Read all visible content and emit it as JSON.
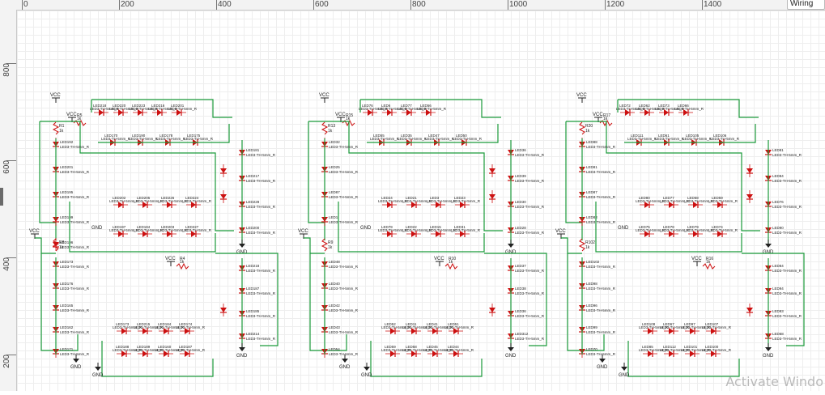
{
  "ruler": {
    "top_labels": [
      "0",
      "200",
      "400",
      "600",
      "800",
      "1000",
      "1200",
      "1400"
    ],
    "left_labels": [
      "800",
      "600",
      "400",
      "200"
    ]
  },
  "top_right_tab": "Wiring",
  "watermark": "Activate Windo",
  "schematic": {
    "net_label_vcc": "VCC",
    "net_label_gnd": "GND",
    "part_name": "LED3-TH-5mm_R",
    "resistor_value": "1k",
    "blocks": [
      {
        "resistors": [
          "R1",
          "R5",
          "R8"
        ],
        "leds_top": [
          "LED218",
          "LED220",
          "LED223",
          "LED216",
          "LED201"
        ],
        "leds_mid": [
          "LED170",
          "LED190",
          "LED178",
          "LED175"
        ],
        "leds_left": [
          "LED192",
          "LED201",
          "LED195",
          "LED199",
          "LED196"
        ],
        "leds_right": [
          "LED181",
          "LED217",
          "LED228",
          "LED200"
        ],
        "leds_row": [
          "LED202",
          "LED205",
          "LED226",
          "LED224",
          "LED197",
          "LED184",
          "LED203",
          "LED227"
        ],
        "leds_lower_left": [
          "LED173",
          "LED176",
          "LED165",
          "LED162",
          "LED171"
        ],
        "leds_lower_right": [
          "LED218",
          "LED187",
          "LED185",
          "LED214"
        ],
        "leds_bottom": [
          "LED173",
          "LED215",
          "LED184",
          "LED174",
          "LED188",
          "LED189",
          "LED160",
          "LED187"
        ]
      },
      {
        "resistors": [
          "R13",
          "R15",
          "R9",
          "R10"
        ],
        "leds_top": [
          "LED76",
          "LED6",
          "LED77",
          "LED56"
        ],
        "leds_mid": [
          "LED55",
          "LED35",
          "LED47",
          "LED50"
        ],
        "leds_left": [
          "LED32",
          "LED25",
          "LED87",
          "LED1"
        ],
        "leds_right": [
          "LED36",
          "LED39",
          "LED30",
          "LED28"
        ],
        "leds_row": [
          "LED24",
          "LED21",
          "LED3",
          "LED23",
          "LED79",
          "LED22",
          "LED15",
          "LED31"
        ],
        "leds_lower_left": [
          "LED48",
          "LED40",
          "LED42",
          "LED43",
          "LED54"
        ],
        "leds_lower_right": [
          "LED37",
          "LED38",
          "LED36",
          "LED312"
        ],
        "leds_bottom": [
          "LED52",
          "LED11",
          "LED41",
          "LED51",
          "LED59",
          "LED58",
          "LED45",
          "LED44"
        ]
      },
      {
        "resistors": [
          "R20",
          "R17",
          "R102",
          "R16"
        ],
        "leds_top": [
          "LED72",
          "LED62",
          "LED73",
          "LED66"
        ],
        "leds_mid": [
          "LED111",
          "LED61",
          "LED105",
          "LED106"
        ],
        "leds_left": [
          "LED88",
          "LED81",
          "LED87",
          "LED83"
        ],
        "leds_right": [
          "LED81",
          "LED84",
          "LED76",
          "LED90"
        ],
        "leds_row": [
          "LED80",
          "LED77",
          "LED58",
          "LED59",
          "LED75",
          "LED78",
          "LED79",
          "LED74"
        ],
        "leds_lower_left": [
          "LED102",
          "LED98",
          "LED96",
          "LED99",
          "LED70"
        ],
        "leds_lower_right": [
          "LED84",
          "LED94",
          "LED93",
          "LED68"
        ],
        "leds_bottom": [
          "LED108",
          "LED67",
          "LED97",
          "LED107",
          "LED85",
          "LED112",
          "LED101",
          "LED100"
        ]
      }
    ]
  }
}
